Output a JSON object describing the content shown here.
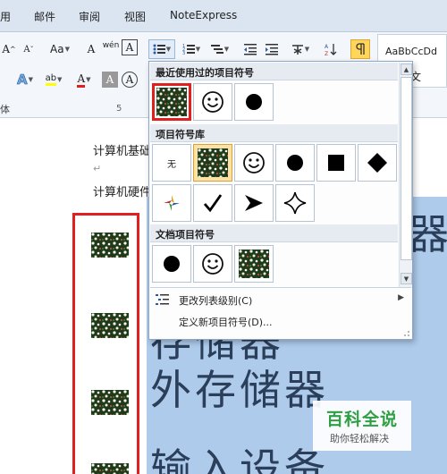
{
  "menubar": {
    "tabs": [
      "用",
      "邮件",
      "审阅",
      "视图",
      "NoteExpress"
    ]
  },
  "ribbon": {
    "font_grow": "A",
    "font_shrink": "A",
    "change_case": "Aa",
    "clear_format": "A",
    "pinyin": "wén",
    "char_border": "A",
    "text_effect": "A",
    "highlight": "ab",
    "font_color": "A",
    "char_shading": "A",
    "char_scale": "A",
    "group_label_font": "体",
    "group_label_para": "5",
    "style_preview": "AaBbCcDd",
    "style_text": "文"
  },
  "dropdown": {
    "recent_title": "最近使用过的项目符号",
    "library_title": "项目符号库",
    "library_none": "无",
    "doc_title": "文档项目符号",
    "change_level": "更改列表级别(C)",
    "define_new": "定义新项目符号(D)..."
  },
  "document": {
    "line1": "计算机基础",
    "line2": "计算机硬件",
    "return_mark": "↵",
    "big_text_1": "存储器",
    "big_text_2": "外存储器",
    "big_text_3": "输入设备",
    "big_fragment": "器"
  },
  "watermark": {
    "title": "百科全说",
    "subtitle": "助你轻松解决"
  },
  "colors": {
    "accent_red": "#e02020",
    "selection": "#aecbec",
    "watermark_green": "#2ea043",
    "hover_gold": "#fbe3a8"
  }
}
